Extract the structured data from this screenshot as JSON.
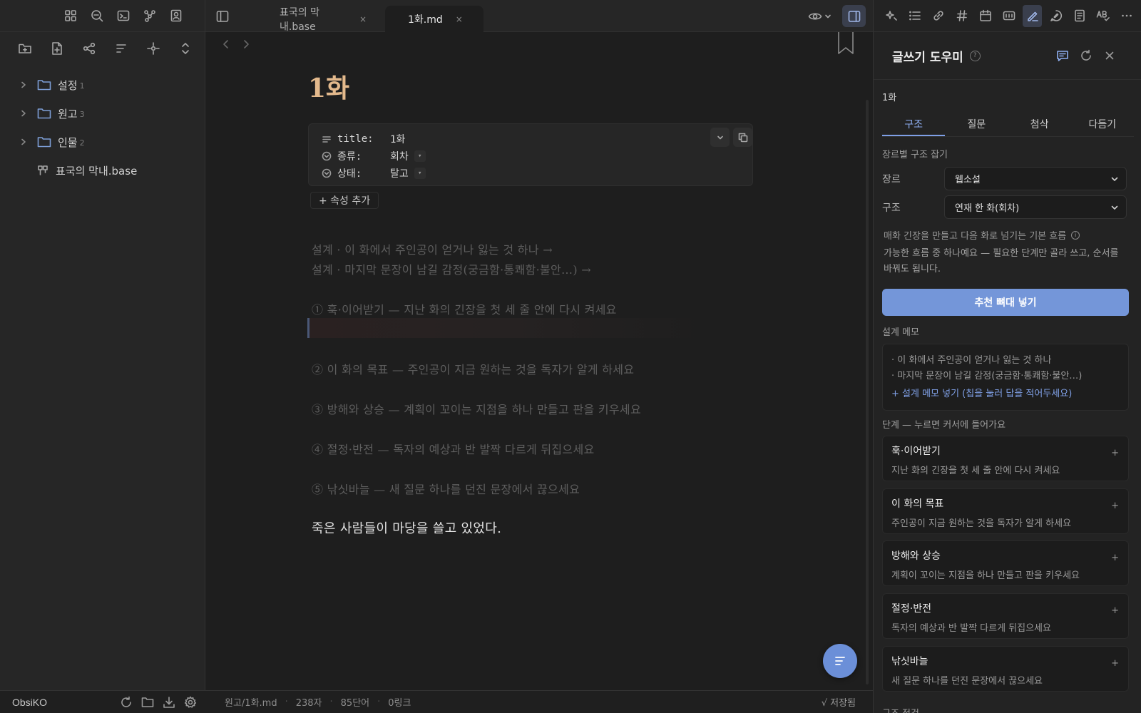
{
  "left_sidebar": {
    "ribbon_icons": [
      "dashboard-icon",
      "search-icon",
      "terminal-icon",
      "graph-icon",
      "profile-icon"
    ],
    "file_actions": [
      "new-folder-icon",
      "new-note-icon",
      "canvas-icon",
      "sort-icon",
      "focus-icon",
      "collapse-icon"
    ],
    "tree": [
      {
        "name": "설정",
        "count": "1"
      },
      {
        "name": "원고",
        "count": "3"
      },
      {
        "name": "인물",
        "count": "2"
      }
    ],
    "file": {
      "name": "표국의 막내.base"
    },
    "vault_name": "ObsiKO"
  },
  "tabs": [
    {
      "label": "표국의 막내.base",
      "close": "×"
    },
    {
      "label": "1화.md",
      "close": "×"
    }
  ],
  "editor": {
    "title": "1화",
    "properties": [
      {
        "key": "title:",
        "value": "1화",
        "icon": "text-icon"
      },
      {
        "key": "종류:",
        "value": "회차",
        "icon": "list-icon"
      },
      {
        "key": "상태:",
        "value": "탈고",
        "icon": "list-icon"
      }
    ],
    "add_property": "+ 속성 추가",
    "lines": [
      "설계 · 이 화에서 주인공이 얻거나 잃는 것 하나 →",
      "설계 · 마지막 문장이 남길 감정(궁금함·통쾌함·불안…) →",
      "① 훅·이어받기 — 지난 화의 긴장을 첫 세 줄 안에 다시 켜세요",
      "② 이 화의 목표 — 주인공이 지금 원하는 것을 독자가 알게 하세요",
      "③ 방해와 상승 — 계획이 꼬이는 지점을 하나 만들고 판을 키우세요",
      "④ 절정·반전 — 독자의 예상과 반 발짝 다르게 뒤집으세요",
      "⑤ 낚싯바늘 — 새 질문 하나를 던진 문장에서 끊으세요"
    ],
    "story_line": "죽은 사람들이 마당을 쓸고 있었다."
  },
  "status_bar": {
    "path": "원고/1화.md",
    "chars": "238자",
    "words": "85단어",
    "links": "0링크",
    "saved": "√ 저장됨"
  },
  "right_panel": {
    "toolbar_icons": [
      "magic-icon",
      "list-icon",
      "link-icon",
      "hashtag-icon",
      "calendar-icon",
      "slides-icon",
      "writing-icon",
      "chat-icon",
      "note-icon",
      "spellcheck-icon",
      "more-icon"
    ],
    "title": "글쓰기 도우미",
    "help": "?",
    "note_title": "1화",
    "tabs": [
      "구조",
      "질문",
      "첨삭",
      "다듬기"
    ],
    "section_genre": "장르별 구조 잡기",
    "genre_label": "장르",
    "genre_value": "웹소설",
    "structure_label": "구조",
    "structure_value": "연재 한 화(회차)",
    "desc1": "매화 긴장을 만들고 다음 화로 넘기는 기본 흐름",
    "desc2": "가능한 흐름 중 하나예요 — 필요한 단계만 골라 쓰고, 순서를 바꿔도 됩니다.",
    "primary_button": "추천 뼈대 넣기",
    "memo_label": "설계 메모",
    "memo_lines": [
      "· 이 화에서 주인공이 얻거나 잃는 것 하나",
      "· 마지막 문장이 남길 감정(궁금함·통쾌함·불안…)"
    ],
    "memo_add": "+ 설계 메모 넣기 (칩을 눌러 답을 적어두세요)",
    "steps_label": "단계 — 누르면 커서에 들어가요",
    "steps": [
      {
        "title": "훅·이어받기",
        "desc": "지난 화의 긴장을 첫 세 줄 안에 다시 켜세요",
        "plus": "+"
      },
      {
        "title": "이 화의 목표",
        "desc": "주인공이 지금 원하는 것을 독자가 알게 하세요",
        "plus": "+"
      },
      {
        "title": "방해와 상승",
        "desc": "계획이 꼬이는 지점을 하나 만들고 판을 키우세요",
        "plus": "+"
      },
      {
        "title": "절정·반전",
        "desc": "독자의 예상과 반 발짝 다르게 뒤집으세요",
        "plus": "+"
      },
      {
        "title": "낚싯바늘",
        "desc": "새 질문 하나를 던진 문장에서 끊으세요",
        "plus": "+"
      }
    ],
    "trailing_label": "구조 점검"
  },
  "colors": {
    "accent": "#7496d9",
    "title": "#e3b98c",
    "folder": "#7e9fd7"
  }
}
